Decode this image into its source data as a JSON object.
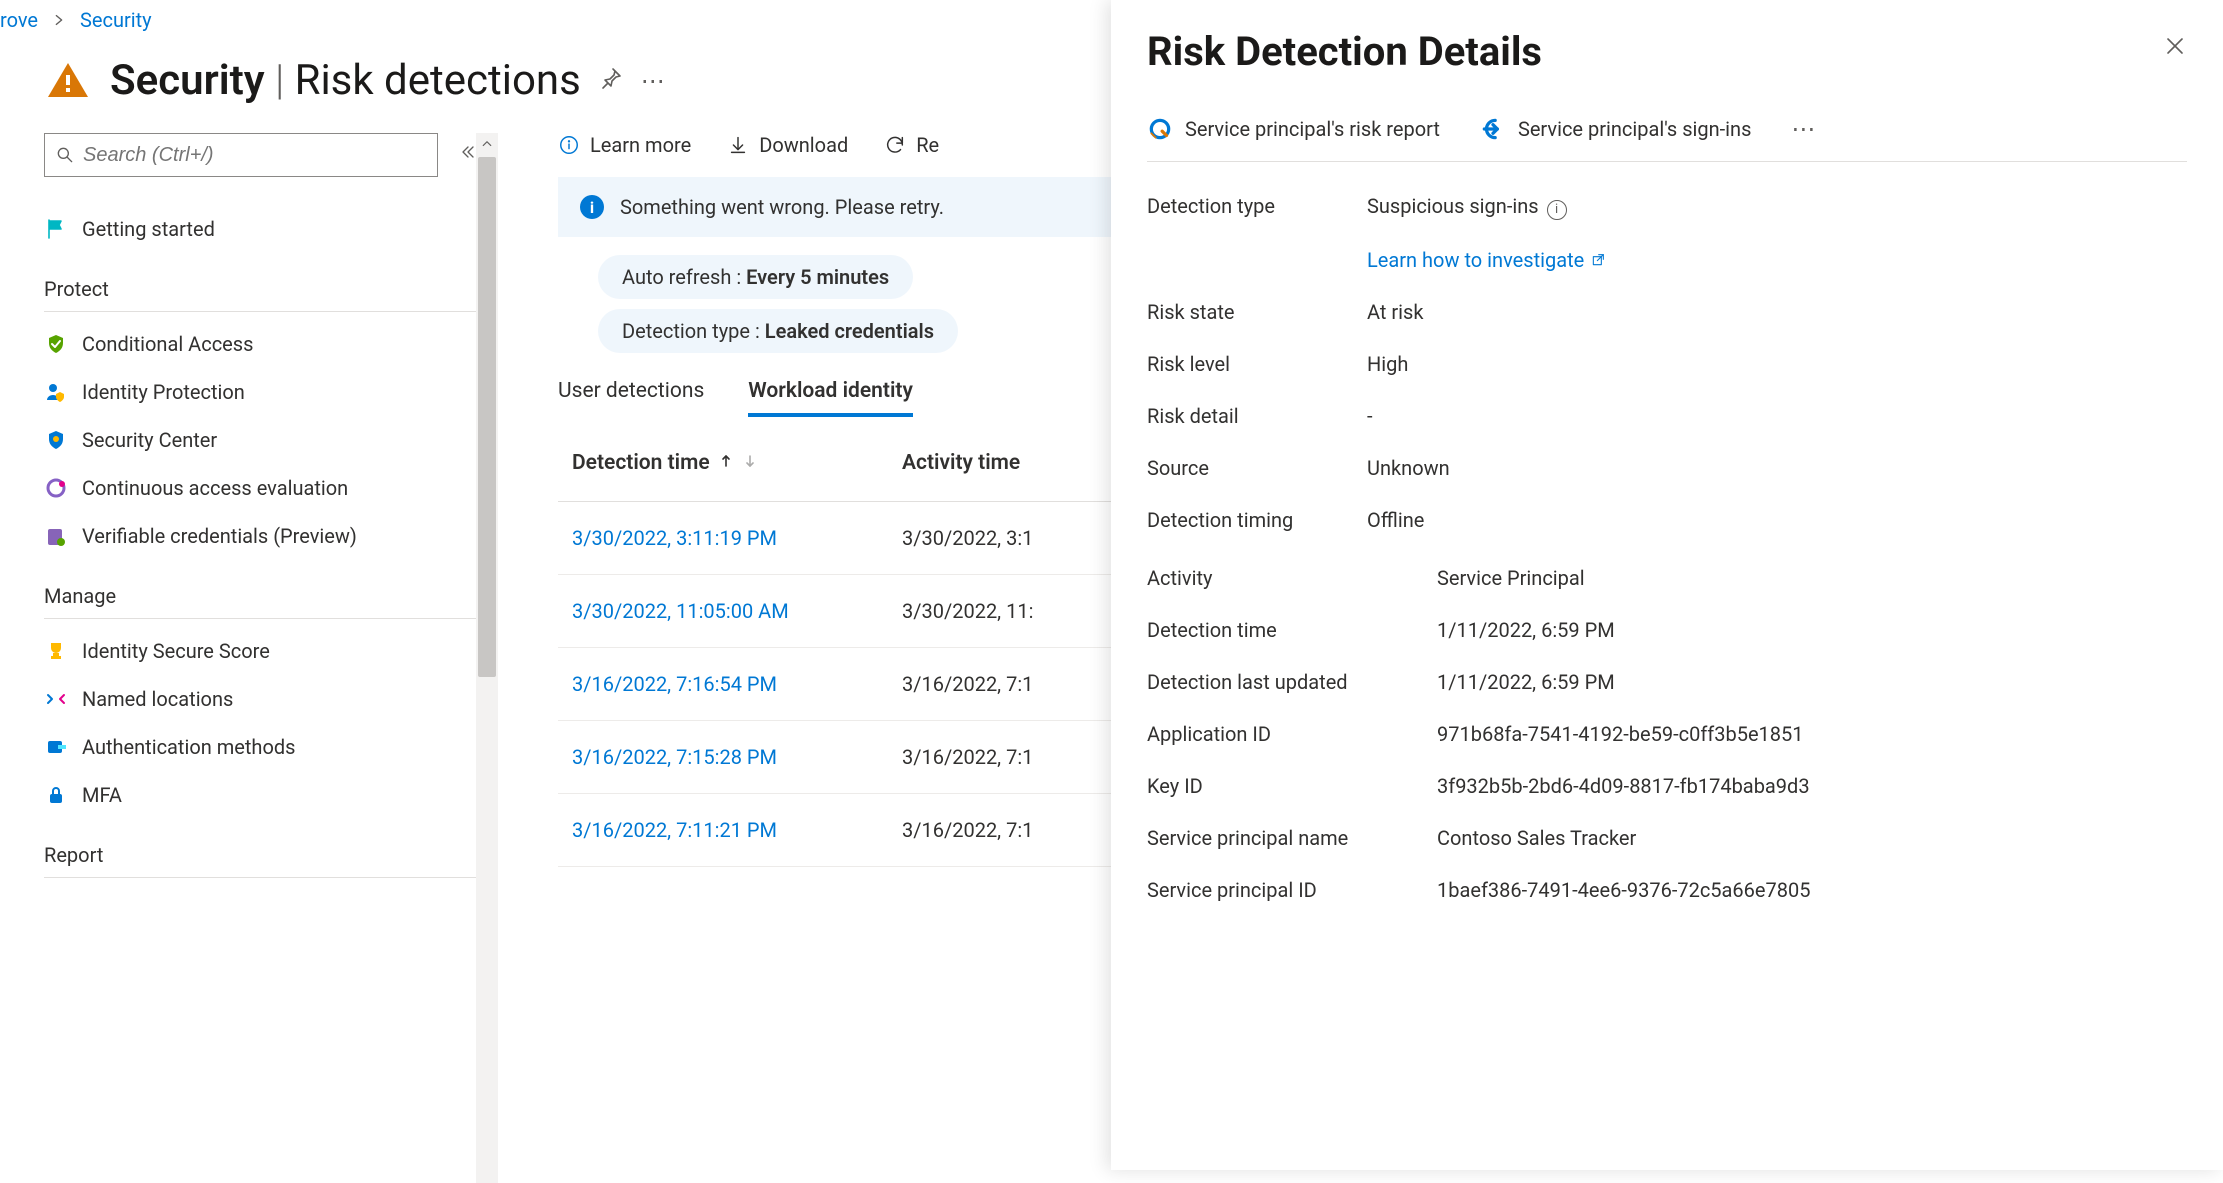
{
  "breadcrumb": {
    "prev": "rove",
    "current": "Security"
  },
  "title": {
    "main": "Security",
    "sub": "Risk detections"
  },
  "search": {
    "placeholder": "Search (Ctrl+/)"
  },
  "sidebar": {
    "getting_started": "Getting started",
    "sections": {
      "protect": "Protect",
      "manage": "Manage",
      "report": "Report"
    },
    "protect_items": [
      {
        "label": "Conditional Access"
      },
      {
        "label": "Identity Protection"
      },
      {
        "label": "Security Center"
      },
      {
        "label": "Continuous access evaluation"
      },
      {
        "label": "Verifiable credentials (Preview)"
      }
    ],
    "manage_items": [
      {
        "label": "Identity Secure Score"
      },
      {
        "label": "Named locations"
      },
      {
        "label": "Authentication methods"
      },
      {
        "label": "MFA"
      }
    ]
  },
  "toolbar": {
    "learn_more": "Learn more",
    "download": "Download",
    "refresh": "Re"
  },
  "banner": {
    "message": "Something went wrong. Please retry."
  },
  "filters": {
    "auto_refresh_label": "Auto refresh : ",
    "auto_refresh_value": "Every 5 minutes",
    "detection_type_label": "Detection type : ",
    "detection_type_value": "Leaked credentials"
  },
  "tabs": {
    "user": "User detections",
    "workload": "Workload identity"
  },
  "table": {
    "col_detection_time": "Detection time",
    "col_activity_time": "Activity time",
    "rows": [
      {
        "detection_time": "3/30/2022, 3:11:19 PM",
        "activity_time": "3/30/2022, 3:1"
      },
      {
        "detection_time": "3/30/2022, 11:05:00 AM",
        "activity_time": "3/30/2022, 11:"
      },
      {
        "detection_time": "3/16/2022, 7:16:54 PM",
        "activity_time": "3/16/2022, 7:1"
      },
      {
        "detection_time": "3/16/2022, 7:15:28 PM",
        "activity_time": "3/16/2022, 7:1"
      },
      {
        "detection_time": "3/16/2022, 7:11:21 PM",
        "activity_time": "3/16/2022, 7:1"
      }
    ]
  },
  "panel": {
    "title": "Risk Detection Details",
    "actions": {
      "risk_report": "Service principal's risk report",
      "sign_ins": "Service principal's sign-ins"
    },
    "fields1": {
      "detection_type_k": "Detection type",
      "detection_type_v": "Suspicious sign-ins",
      "learn_link": "Learn how to investigate",
      "risk_state_k": "Risk state",
      "risk_state_v": "At risk",
      "risk_level_k": "Risk level",
      "risk_level_v": "High",
      "risk_detail_k": "Risk detail",
      "risk_detail_v": "-",
      "source_k": "Source",
      "source_v": "Unknown",
      "detection_timing_k": "Detection timing",
      "detection_timing_v": "Offline"
    },
    "fields2": {
      "activity_k": "Activity",
      "activity_v": "Service Principal",
      "detection_time_k": "Detection time",
      "detection_time_v": "1/11/2022, 6:59 PM",
      "detection_last_k": "Detection last updated",
      "detection_last_v": "1/11/2022, 6:59 PM",
      "app_id_k": "Application ID",
      "app_id_v": "971b68fa-7541-4192-be59-c0ff3b5e1851",
      "key_id_k": "Key ID",
      "key_id_v": "3f932b5b-2bd6-4d09-8817-fb174baba9d3",
      "sp_name_k": "Service principal name",
      "sp_name_v": "Contoso Sales Tracker",
      "sp_id_k": "Service principal ID",
      "sp_id_v": "1baef386-7491-4ee6-9376-72c5a66e7805"
    }
  }
}
